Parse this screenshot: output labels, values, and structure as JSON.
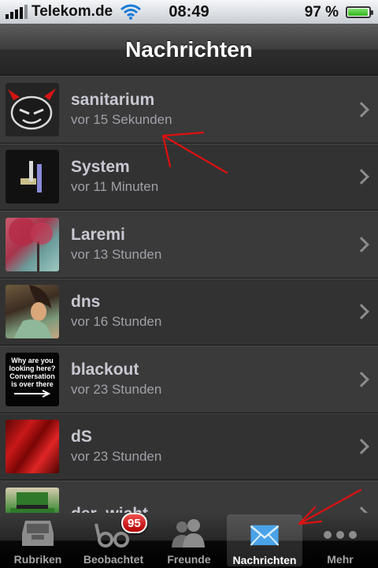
{
  "status": {
    "carrier": "Telekom.de",
    "time": "08:49",
    "battery_percent": "97 %",
    "battery_level": 0.97,
    "signal_bars": 4
  },
  "nav": {
    "title": "Nachrichten"
  },
  "conversations": [
    {
      "name": "sanitarium",
      "time": "vor 15 Sekunden",
      "avatar": "devil-face-icon"
    },
    {
      "name": "System",
      "time": "vor 11 Minuten",
      "avatar": "system-logo-icon"
    },
    {
      "name": "Laremi",
      "time": "vor 13 Stunden",
      "avatar": "red-tree-picture"
    },
    {
      "name": "dns",
      "time": "vor 16 Stunden",
      "avatar": "anime-character-picture"
    },
    {
      "name": "blackout",
      "time": "vor 23 Stunden",
      "avatar": "text-picture",
      "avatar_text": "Why are you looking here? Conversation is over there"
    },
    {
      "name": "dS",
      "time": "vor 23 Stunden",
      "avatar": "red-abstract-picture"
    },
    {
      "name": "der_wicht",
      "time": "",
      "avatar": "leprechaun-picture"
    }
  ],
  "tabs": [
    {
      "label": "Rubriken",
      "icon": "inbox-tray-icon"
    },
    {
      "label": "Beobachtet",
      "icon": "glasses-icon",
      "badge": "95"
    },
    {
      "label": "Freunde",
      "icon": "people-icon"
    },
    {
      "label": "Nachrichten",
      "icon": "envelope-icon",
      "active": true
    },
    {
      "label": "Mehr",
      "icon": "more-dots-icon"
    }
  ],
  "colors": {
    "annotation": "#e01010",
    "badge": "#d21b1b",
    "envelope": "#4aa3e8"
  }
}
